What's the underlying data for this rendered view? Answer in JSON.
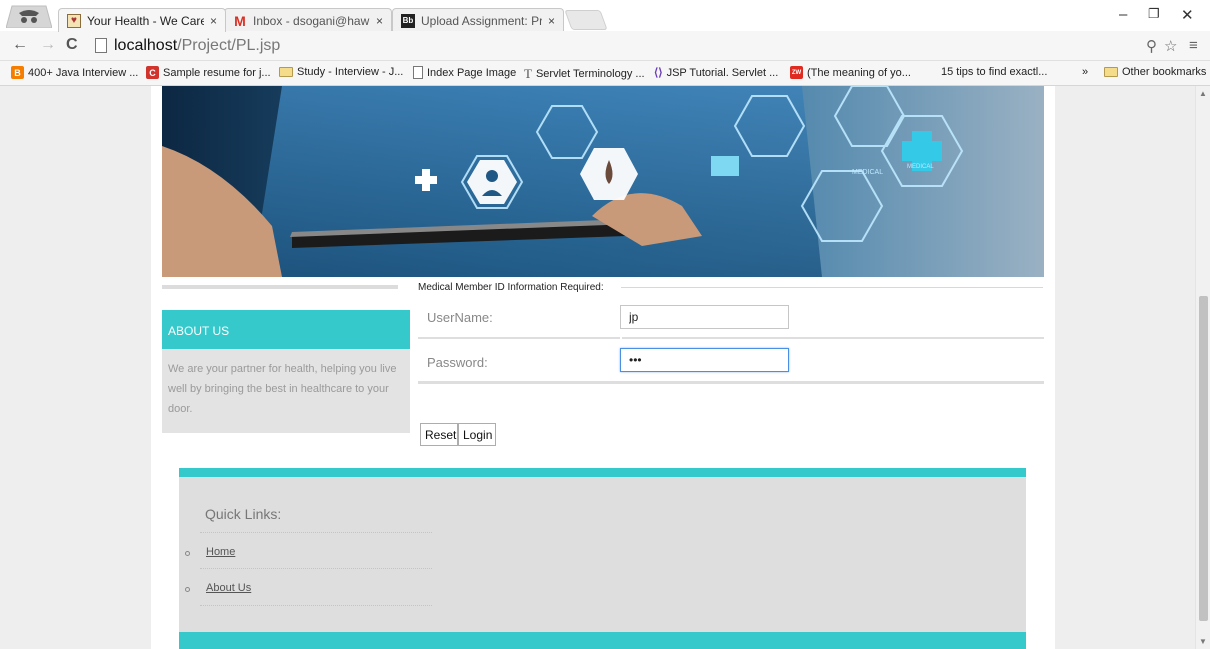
{
  "browser": {
    "tabs": [
      {
        "title": "Your Health - We Care!",
        "close": "×",
        "active": true
      },
      {
        "title": "Inbox - dsogani@hawk.iit.",
        "close": "×",
        "active": false
      },
      {
        "title": "Upload Assignment: Proje",
        "close": "×",
        "active": false
      }
    ],
    "url_host": "localhost",
    "url_path": "/Project/PL.jsp",
    "bookmarks": [
      "400+ Java Interview ...",
      "Sample resume for j...",
      "Study - Interview - J...",
      "Index Page Image",
      "Servlet Terminology ...",
      "JSP Tutorial. Servlet ...",
      "(The meaning of yo...",
      "15 tips to find exactl..."
    ],
    "overflow": "»",
    "other_bookmarks": "Other bookmarks"
  },
  "page": {
    "about": {
      "title": "ABOUT US",
      "text": "We are your partner for health, helping you live well by bringing the best in healthcare to your door."
    },
    "form": {
      "heading": "Medical Member ID Information Required:",
      "username_label": "UserName:",
      "username_value": "jp",
      "password_label": "Password:",
      "password_value": "•••",
      "reset_label": "Reset",
      "login_label": "Login"
    },
    "footer": {
      "quick_links_title": "Quick Links:",
      "links": [
        "Home",
        "About Us"
      ]
    }
  },
  "colors": {
    "accent": "#35c9cb",
    "panel_gray": "#e3e3e3",
    "footer_gray": "#dedede"
  }
}
